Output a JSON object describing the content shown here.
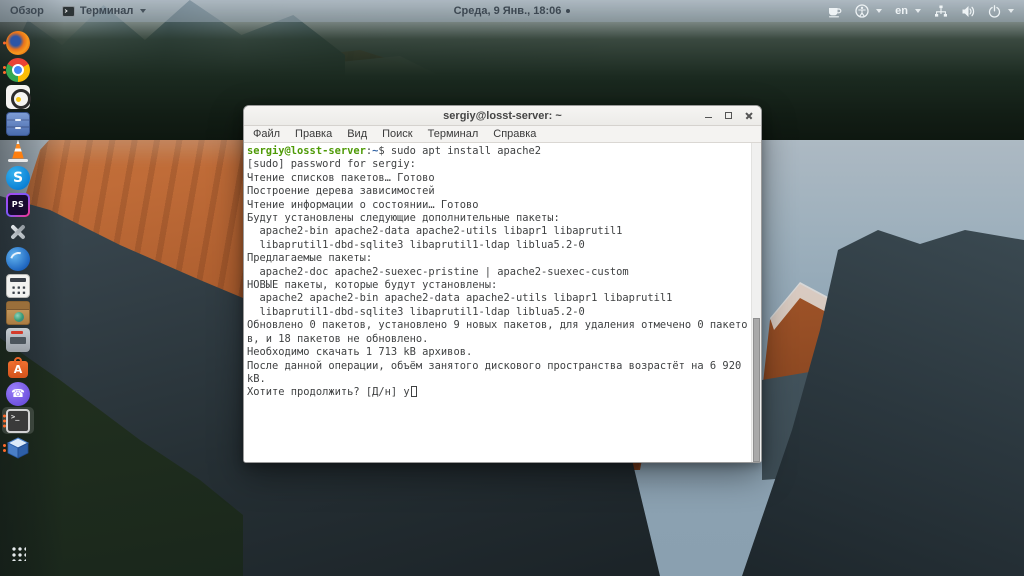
{
  "top_bar": {
    "activities_label": "Обзор",
    "focused_app": {
      "label": "Терминал"
    },
    "clock": "Среда, 9 Янв., 18:06",
    "keyboard_layout": "en",
    "status_icons": [
      "coffee-indicator",
      "accessibility-menu",
      "keyboard-layout",
      "network-wired",
      "volume",
      "power"
    ]
  },
  "dock": {
    "items": [
      {
        "name": "firefox",
        "indicators": 1
      },
      {
        "name": "chrome",
        "indicators": 2
      },
      {
        "name": "media-player",
        "indicators": 0
      },
      {
        "name": "file-cabinet",
        "indicators": 0
      },
      {
        "name": "vlc",
        "indicators": 0
      },
      {
        "name": "skype",
        "indicators": 0
      },
      {
        "name": "phpstorm",
        "indicators": 0
      },
      {
        "name": "tweak-tools",
        "indicators": 0
      },
      {
        "name": "thunderbird",
        "indicators": 0
      },
      {
        "name": "calculator",
        "indicators": 0
      },
      {
        "name": "package-manager",
        "indicators": 0
      },
      {
        "name": "scanner",
        "indicators": 0
      },
      {
        "name": "software-store",
        "indicators": 0
      },
      {
        "name": "viber",
        "indicators": 0
      },
      {
        "name": "terminal",
        "indicators": 3,
        "active": true
      },
      {
        "name": "virtualbox",
        "indicators": 2
      },
      {
        "name": "show-applications",
        "indicators": 0
      }
    ]
  },
  "terminal": {
    "title": "sergiy@losst-server: ~",
    "window_buttons": [
      "minimize",
      "maximize",
      "close"
    ],
    "menu_items": [
      "Файл",
      "Правка",
      "Вид",
      "Поиск",
      "Терминал",
      "Справка"
    ],
    "prompt": {
      "user_host": "sergiy@losst-server",
      "colon": ":",
      "path": "~",
      "rest": "$ sudo apt install apache2"
    },
    "output_lines": [
      "[sudo] password for sergiy: ",
      "Чтение списков пакетов… Готово",
      "Построение дерева зависимостей",
      "Чтение информации о состоянии… Готово",
      "Будут установлены следующие дополнительные пакеты:",
      "  apache2-bin apache2-data apache2-utils libapr1 libaprutil1",
      "  libaprutil1-dbd-sqlite3 libaprutil1-ldap liblua5.2-0",
      "Предлагаемые пакеты:",
      "  apache2-doc apache2-suexec-pristine | apache2-suexec-custom",
      "НОВЫЕ пакеты, которые будут установлены:",
      "  apache2 apache2-bin apache2-data apache2-utils libapr1 libaprutil1",
      "  libaprutil1-dbd-sqlite3 libaprutil1-ldap liblua5.2-0",
      "Обновлено 0 пакетов, установлено 9 новых пакетов, для удаления отмечено 0 пакето",
      "в, и 18 пакетов не обновлено.",
      "Необходимо скачать 1 713 kB архивов.",
      "После данной операции, объём занятого дискового пространства возрастёт на 6 920",
      "kB."
    ],
    "input_line": "Хотите продолжить? [Д/н] y"
  },
  "colors": {
    "prompt_green": "#4E9A06",
    "path_blue": "#3465A4",
    "terminal_text": "#3F4142",
    "dock_indicator": "#FF6A2A",
    "panel_text": "#3D4852"
  }
}
